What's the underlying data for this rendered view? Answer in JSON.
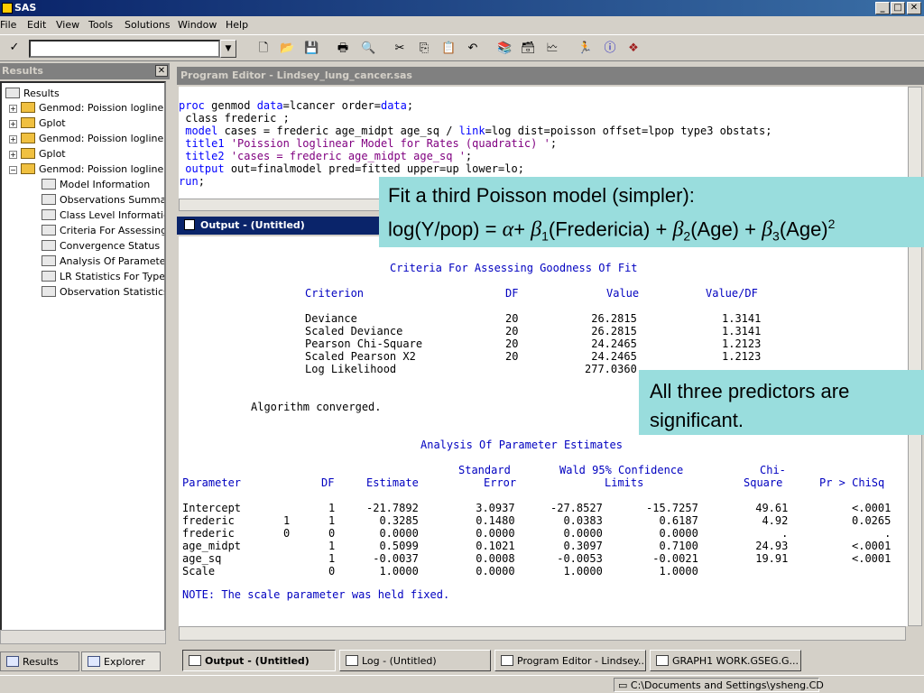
{
  "window": {
    "title": "SAS"
  },
  "menu": [
    "File",
    "Edit",
    "View",
    "Tools",
    "Solutions",
    "Window",
    "Help"
  ],
  "toolbar": {
    "check_label": "✓",
    "command_value": ""
  },
  "results_panel": {
    "title": "Results",
    "root": "Results",
    "items": [
      "Genmod:  Poission loglinea",
      "Gplot",
      "Genmod:  Poission loglinea",
      "Gplot",
      "Genmod:  Poission loglinea"
    ],
    "children": [
      "Model Information",
      "Observations Summar",
      "Class Level Informatic",
      "Criteria For Assessing",
      "Convergence Status",
      "Analysis Of Paramete",
      "LR Statistics For Type",
      "Observation Statistics"
    ],
    "tabs": [
      "Results",
      "Explorer"
    ]
  },
  "editor": {
    "title": "Program Editor - Lindsey_lung_cancer.sas"
  },
  "output": {
    "title": "Output - (Untitled)",
    "gof_title": "Criteria For Assessing Goodness Of Fit",
    "gof_header": {
      "criterion": "Criterion",
      "df": "DF",
      "value": "Value",
      "value_df": "Value/DF"
    },
    "gof_rows": [
      {
        "name": "Deviance",
        "df": "20",
        "value": "26.2815",
        "vdf": "1.3141"
      },
      {
        "name": "Scaled Deviance",
        "df": "20",
        "value": "26.2815",
        "vdf": "1.3141"
      },
      {
        "name": "Pearson Chi-Square",
        "df": "20",
        "value": "24.2465",
        "vdf": "1.2123"
      },
      {
        "name": "Scaled Pearson X2",
        "df": "20",
        "value": "24.2465",
        "vdf": "1.2123"
      },
      {
        "name": "Log Likelihood",
        "df": "",
        "value": "277.0360",
        "vdf": ""
      }
    ],
    "converged": "Algorithm converged.",
    "pe_title": "Analysis Of Parameter Estimates",
    "pe_header1": {
      "stderr": "Standard",
      "wald": "Wald 95% Confidence",
      "chi": "Chi-"
    },
    "pe_header2": {
      "param": "Parameter",
      "df": "DF",
      "est": "Estimate",
      "err": "Error",
      "limits": "Limits",
      "sq": "Square",
      "pr": "Pr > ChiSq"
    },
    "pe_rows": [
      {
        "param": "Intercept",
        "lvl": "",
        "df": "1",
        "est": "-21.7892",
        "se": "3.0937",
        "lo": "-27.8527",
        "hi": "-15.7257",
        "chi": "49.61",
        "p": "<.0001"
      },
      {
        "param": "frederic",
        "lvl": "1",
        "df": "1",
        "est": "0.3285",
        "se": "0.1480",
        "lo": "0.0383",
        "hi": "0.6187",
        "chi": "4.92",
        "p": "0.0265"
      },
      {
        "param": "frederic",
        "lvl": "0",
        "df": "0",
        "est": "0.0000",
        "se": "0.0000",
        "lo": "0.0000",
        "hi": "0.0000",
        "chi": ".",
        "p": "."
      },
      {
        "param": "age_midpt",
        "lvl": "",
        "df": "1",
        "est": "0.5099",
        "se": "0.1021",
        "lo": "0.3097",
        "hi": "0.7100",
        "chi": "24.93",
        "p": "<.0001"
      },
      {
        "param": "age_sq",
        "lvl": "",
        "df": "1",
        "est": "-0.0037",
        "se": "0.0008",
        "lo": "-0.0053",
        "hi": "-0.0021",
        "chi": "19.91",
        "p": "<.0001"
      },
      {
        "param": "Scale",
        "lvl": "",
        "df": "0",
        "est": "1.0000",
        "se": "0.0000",
        "lo": "1.0000",
        "hi": "1.0000",
        "chi": "",
        "p": ""
      }
    ],
    "note": "NOTE: The scale parameter was held fixed."
  },
  "callouts": {
    "model_line1": "Fit a third Poisson model (simpler):",
    "predictors_note": "All three predictors are significant."
  },
  "taskbar": [
    "Output - (Untitled)",
    "Log - (Untitled)",
    "Program Editor - Lindsey...",
    "GRAPH1  WORK.GSEG.G..."
  ],
  "status": {
    "path": "C:\\Documents and Settings\\ysheng.CD"
  },
  "colors": {
    "keyword": "#0000ff",
    "string": "#800080",
    "output_text": "#0000c0",
    "callout_bg": "#99dddd",
    "titlebar": "#0a246a"
  }
}
